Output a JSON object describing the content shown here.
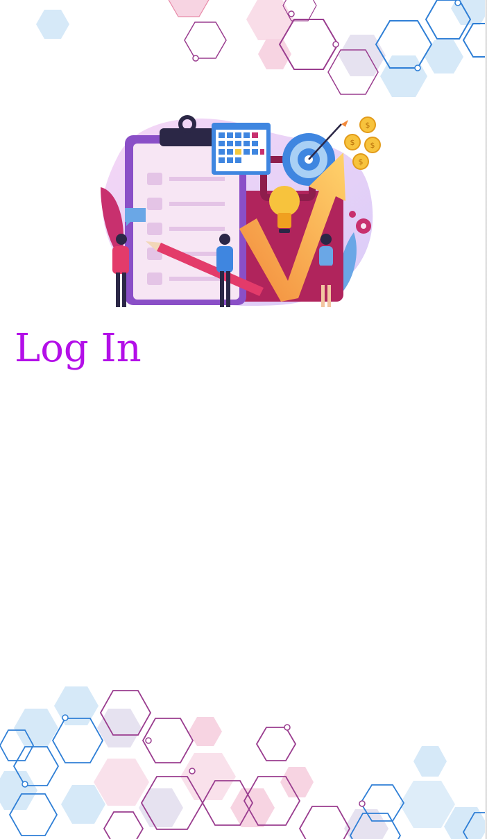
{
  "page": {
    "title": "Log In"
  },
  "theme": {
    "title_color": "#b30fe8",
    "hex_blue": "#2f7fd6",
    "hex_purple": "#9a3d8f",
    "hex_pink": "#e88aa8",
    "hex_fill_blue": "#d6e9f8",
    "hex_fill_pink": "#f7d4e2"
  },
  "illustration": {
    "icons": [
      "clipboard-icon",
      "calendar-icon",
      "target-icon",
      "lightbulb-icon",
      "dollar-coin-icon",
      "gear-icon",
      "pencil-icon",
      "growth-arrow-icon"
    ]
  }
}
